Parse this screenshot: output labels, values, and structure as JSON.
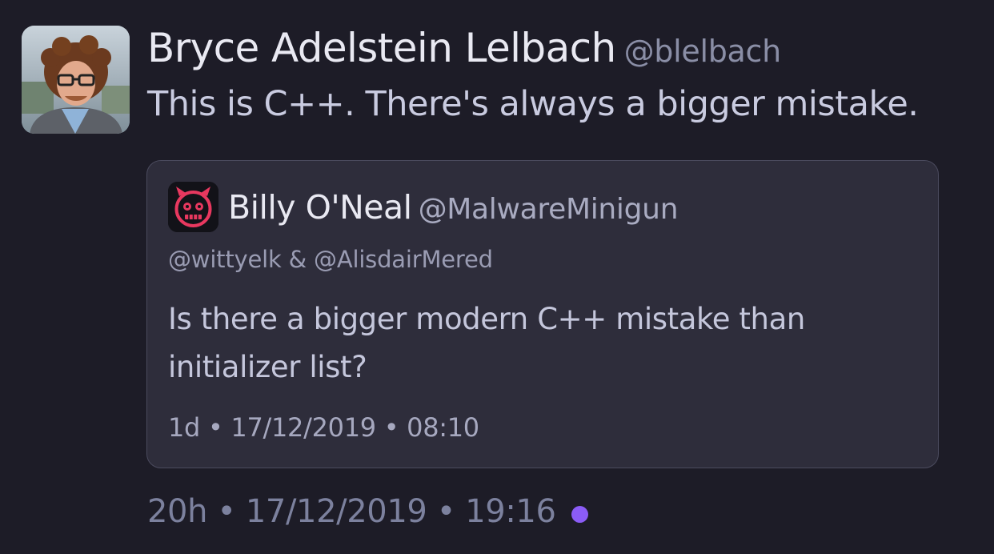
{
  "tweet": {
    "author": {
      "name": "Bryce Adelstein Lelbach",
      "handle": "@blelbach"
    },
    "text": "This is C++. There's always a bigger mistake.",
    "meta": "20h • 17/12/2019 • 19:16",
    "status_dot_color": "#8b5cf6"
  },
  "quote": {
    "author": {
      "name": "Billy O'Neal",
      "handle": "@MalwareMinigun"
    },
    "reply_to": "@wittyelk & @AlisdairMered",
    "text": "Is there a bigger modern C++ mistake than initializer list?",
    "meta": "1d • 17/12/2019 • 08:10"
  },
  "icons": {
    "author_avatar": "person-photo-avatar",
    "quote_avatar": "robot-face-avatar"
  },
  "colors": {
    "background": "#1d1c27",
    "card_background": "#2e2d3b",
    "card_border": "#4b4b5e",
    "accent": "#8b5cf6",
    "quote_avatar_accent": "#e8385f"
  }
}
